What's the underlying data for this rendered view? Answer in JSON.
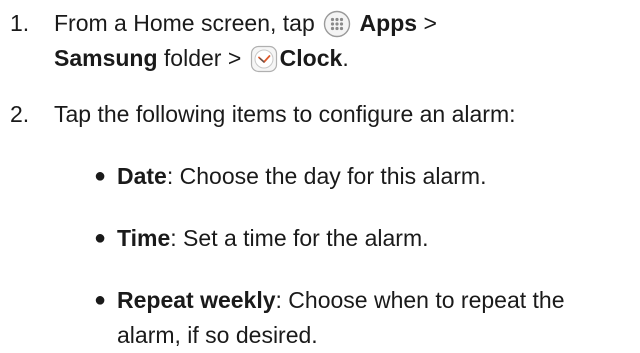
{
  "steps": [
    {
      "number": "1.",
      "line1_pre": "From a Home screen, tap",
      "apps_label": "Apps",
      "line1_sep": ">",
      "folder_label": "Samsung",
      "folder_suffix": "folder >",
      "clock_label": "Clock",
      "end_period": "."
    },
    {
      "number": "2.",
      "text": "Tap the following items to configure an alarm:"
    }
  ],
  "bullets": [
    {
      "term": "Date",
      "desc": ": Choose the day for this alarm."
    },
    {
      "term": "Time",
      "desc": ": Set a time for the alarm."
    },
    {
      "term": "Repeat weekly",
      "desc": ": Choose when to repeat the",
      "desc2": "alarm, if so desired."
    }
  ],
  "icons": {
    "apps": "apps-grid-icon",
    "clock": "clock-icon"
  },
  "colors": {
    "text": "#1a1a1a",
    "icon_border": "#9a9a9a",
    "clock_accent": "#e05a2b"
  }
}
